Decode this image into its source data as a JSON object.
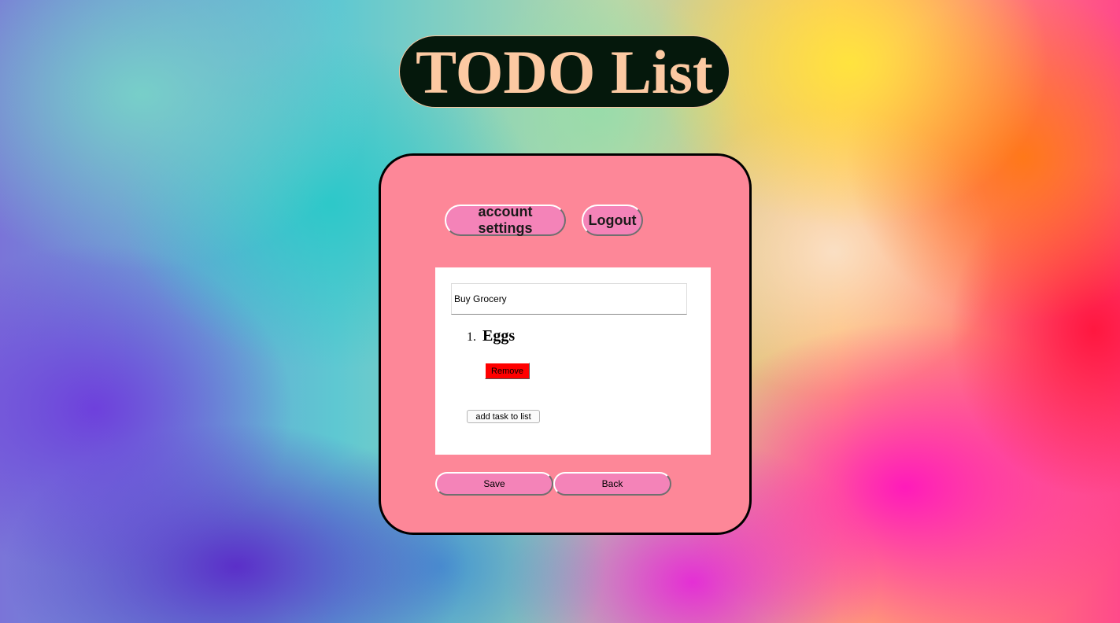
{
  "header": {
    "title": "TODO List"
  },
  "nav": {
    "account_settings_label": "account settings",
    "logout_label": "Logout"
  },
  "list": {
    "name_value": "Buy Grocery",
    "tasks": [
      {
        "number": "1.",
        "name": "Eggs",
        "remove_label": "Remove"
      }
    ],
    "add_task_label": "add task to list"
  },
  "actions": {
    "save_label": "Save",
    "back_label": "Back"
  },
  "colors": {
    "title_pill_bg": "#05180c",
    "title_text": "#fcc9a2",
    "card_bg": "#fd8798",
    "button_pink": "#f483b8",
    "remove_red": "#ff0000"
  }
}
